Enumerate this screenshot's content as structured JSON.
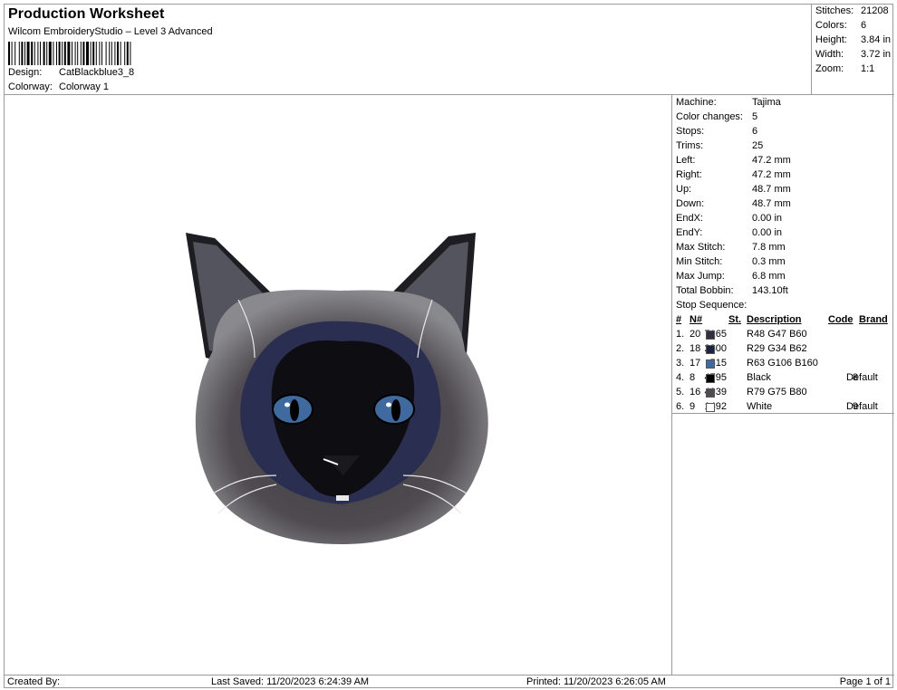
{
  "header": {
    "title": "Production Worksheet",
    "subtitle": "Wilcom EmbroideryStudio – Level 3 Advanced",
    "design_label": "Design:",
    "design_value": "CatBlackblue3_8",
    "colorway_label": "Colorway:",
    "colorway_value": "Colorway 1"
  },
  "summary": [
    {
      "label": "Stitches:",
      "value": "21208"
    },
    {
      "label": "Colors:",
      "value": "6"
    },
    {
      "label": "Height:",
      "value": "3.84 in"
    },
    {
      "label": "Width:",
      "value": "3.72 in"
    },
    {
      "label": "Zoom:",
      "value": "1:1"
    }
  ],
  "stats": [
    {
      "label": "Machine:",
      "value": "Tajima"
    },
    {
      "label": "Color changes:",
      "value": "5"
    },
    {
      "label": "Stops:",
      "value": "6"
    },
    {
      "label": "Trims:",
      "value": "25"
    },
    {
      "label": "Left:",
      "value": "47.2 mm"
    },
    {
      "label": "Right:",
      "value": "47.2 mm"
    },
    {
      "label": "Up:",
      "value": "48.7 mm"
    },
    {
      "label": "Down:",
      "value": "48.7 mm"
    },
    {
      "label": "EndX:",
      "value": "0.00 in"
    },
    {
      "label": "EndY:",
      "value": "0.00 in"
    },
    {
      "label": "Max Stitch:",
      "value": "7.8 mm"
    },
    {
      "label": "Min Stitch:",
      "value": "0.3 mm"
    },
    {
      "label": "Max Jump:",
      "value": "6.8 mm"
    },
    {
      "label": "Total Bobbin:",
      "value": "143.10ft"
    }
  ],
  "stop_sequence": {
    "label": "Stop Sequence:",
    "headers": {
      "num": "#",
      "n": "N#",
      "st": "St.",
      "desc": "Description",
      "code": "Code",
      "brand": "Brand"
    },
    "rows": [
      {
        "num": "1.",
        "n": "20",
        "color": "#30303c",
        "st": "7165",
        "desc": "R48 G47 B60",
        "code": "",
        "brand": ""
      },
      {
        "num": "2.",
        "n": "18",
        "color": "#1d223e",
        "st": "2300",
        "desc": "R29 G34 B62",
        "code": "",
        "brand": ""
      },
      {
        "num": "3.",
        "n": "17",
        "color": "#3f6aa0",
        "st": "515",
        "desc": "R63 G106 B160",
        "code": "",
        "brand": ""
      },
      {
        "num": "4.",
        "n": "8",
        "color": "#000000",
        "st": "4795",
        "desc": "Black",
        "code": "8",
        "brand": "Default"
      },
      {
        "num": "5.",
        "n": "16",
        "color": "#4f4b50",
        "st": "4939",
        "desc": "R79 G75 B80",
        "code": "",
        "brand": ""
      },
      {
        "num": "6.",
        "n": "9",
        "color": "#ffffff",
        "st": "1492",
        "desc": "White",
        "code": "9",
        "brand": "Default"
      }
    ]
  },
  "footer": {
    "created_by": "Created By:",
    "last_saved": "Last Saved: 11/20/2023 6:24:39 AM",
    "printed": "Printed: 11/20/2023 6:26:05 AM",
    "page": "Page 1 of 1"
  }
}
